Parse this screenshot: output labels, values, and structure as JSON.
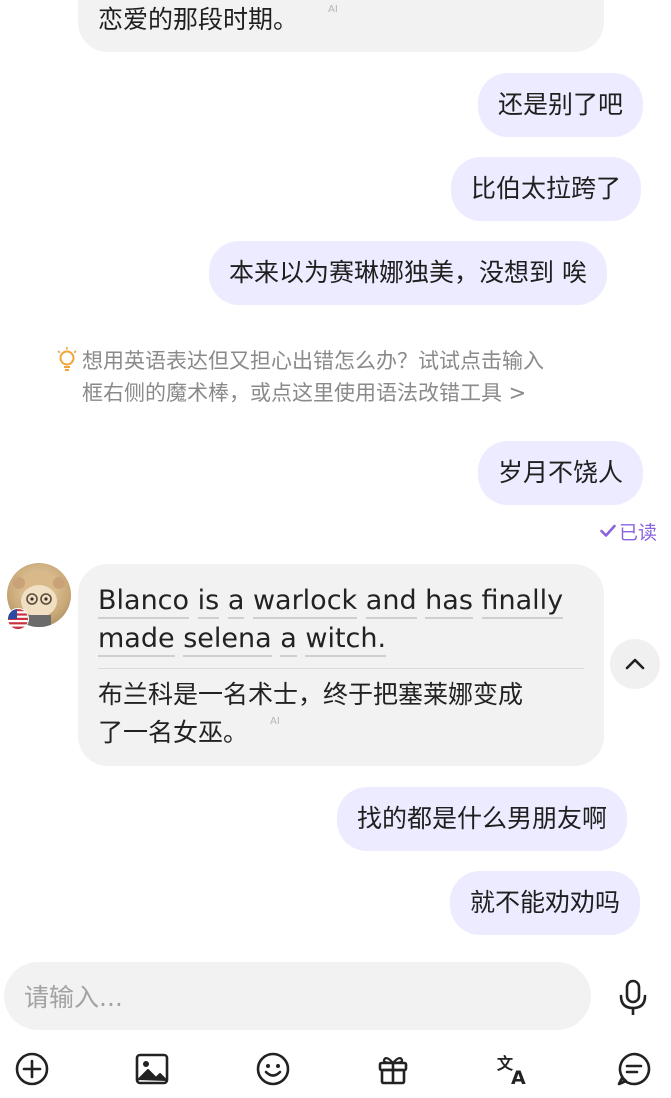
{
  "messages": {
    "partial_incoming": "恋爱的那段时期。",
    "ai_label": "AI",
    "out1": "还是别了吧",
    "out2": "比伯太拉跨了",
    "out3": "本来以为赛琳娜独美，没想到  唉",
    "tip_line1": "想用英语表达但又担心出错怎么办？试试点击输入",
    "tip_line2": "框右侧的魔术棒，或点这里使用语法改错工具 >",
    "out4": "岁月不饶人",
    "read_status": "已读",
    "incoming_en_words": [
      "Blanco",
      "is",
      "a",
      "warlock",
      "and",
      "has",
      "finally",
      "made",
      "selena",
      "a",
      "witch."
    ],
    "incoming_zh_line1": "布兰科是一名术士，终于把塞莱娜变成",
    "incoming_zh_line2": "了一名女巫。",
    "out5": "找的都是什么男朋友啊",
    "out6": "就不能劝劝吗"
  },
  "input": {
    "placeholder": "请输入..."
  },
  "toolbar_icons": [
    "add-icon",
    "image-icon",
    "emoji-icon",
    "gift-icon",
    "translate-icon",
    "chat-icon"
  ],
  "colors": {
    "outgoing_bubble": "#ecebff",
    "incoming_bubble": "#f2f2f3",
    "accent": "#8a63e0"
  }
}
